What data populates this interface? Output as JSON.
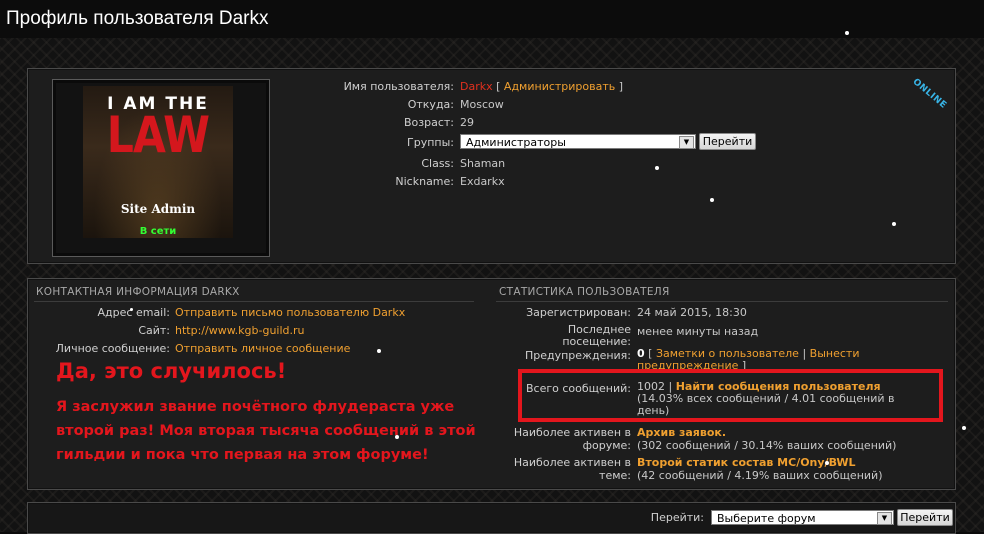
{
  "page": {
    "title": "Профиль пользователя Darkx"
  },
  "avatar": {
    "line1": "I AM THE",
    "line2": "LAW",
    "rank": "Site Admin",
    "status": "В сети"
  },
  "online_badge": "ONLINE",
  "profile": {
    "username_label": "Имя пользователя:",
    "username": "Darkx",
    "admin_open": "[",
    "admin_link": "Администрировать",
    "admin_close": "]",
    "from_label": "Откуда:",
    "from": "Moscow",
    "age_label": "Возраст:",
    "age": "29",
    "groups_label": "Группы:",
    "groups_selected": "Администраторы",
    "groups_button": "Перейти",
    "class_label": "Class:",
    "class": "Shaman",
    "nickname_label": "Nickname:",
    "nickname": "Exdarkx"
  },
  "contact": {
    "header": "КОНТАКТНАЯ ИНФОРМАЦИЯ DARKX",
    "email_label": "Адрес email:",
    "email_link": "Отправить письмо пользователю Darkx",
    "site_label": "Сайт:",
    "site_link": "http://www.kgb-guild.ru",
    "pm_label": "Личное сообщение:",
    "pm_link": "Отправить личное сообщение"
  },
  "overlay": {
    "headline": "Да, это случилось!",
    "message": "Я заслужил звание почётного флудераста уже второй раз! Моя вторая тысяча сообщений в этой гильдии и пока что первая на этом форуме!"
  },
  "stats": {
    "header": "СТАТИСТИКА ПОЛЬЗОВАТЕЛЯ",
    "registered_label": "Зарегистрирован:",
    "registered": "24 май 2015, 18:30",
    "last_visit_label_1": "Последнее",
    "last_visit_label_2": "посещение:",
    "last_visit": "менее минуты назад",
    "warnings_label": "Предупреждения:",
    "warnings_count": "0",
    "warnings_open": "[",
    "warnings_notes": "Заметки о пользователе",
    "warnings_sep": "|",
    "warnings_issue_1": "Вынести",
    "warnings_issue_2": "предупреждение",
    "warnings_close": "]",
    "posts_label": "Всего сообщений:",
    "posts": "1002",
    "posts_sep": "|",
    "posts_link": "Найти сообщения пользователя",
    "posts_detail_1": "(14.03% всех сообщений / 4.01 сообщений в",
    "posts_detail_2": "день)",
    "active_forum_label_1": "Наиболее активен в",
    "active_forum_label_2": "форуме:",
    "active_forum": "Архив заявок.",
    "active_forum_detail": "(302 сообщений / 30.14% ваших сообщений)",
    "active_topic_label_1": "Наиболее активен в",
    "active_topic_label_2": "теме:",
    "active_topic": "Второй статик состав MC/Ony/BWL",
    "active_topic_detail": "(42 сообщений / 4.19% ваших сообщений)"
  },
  "nav": {
    "label": "Перейти:",
    "select": "Выберите форум",
    "button": "Перейти"
  }
}
